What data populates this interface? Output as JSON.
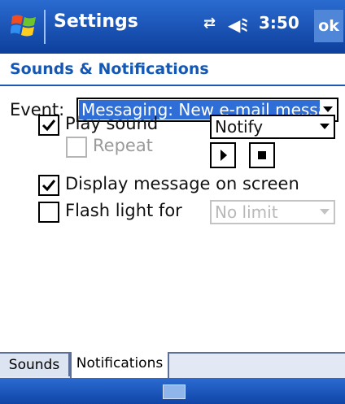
{
  "titlebar": {
    "title": "Settings",
    "connectivity_icon": "connectivity-icon",
    "volume_icon": "volume-icon",
    "time": "3:50",
    "ok_label": "ok"
  },
  "page": {
    "title": "Sounds & Notifications"
  },
  "event": {
    "label": "Event:",
    "value": "Messaging: New e-mail messag"
  },
  "play_sound": {
    "label": "Play sound",
    "checked": true,
    "sound_value": "Notify",
    "play_icon": "play-icon",
    "stop_icon": "stop-icon"
  },
  "repeat": {
    "label": "Repeat",
    "checked": false,
    "enabled": false
  },
  "display_message": {
    "label": "Display message on screen",
    "checked": true
  },
  "flash_light": {
    "label": "Flash light for",
    "checked": false,
    "duration_value": "No limit",
    "enabled": false
  },
  "tabs": [
    {
      "label": "Sounds",
      "active": false
    },
    {
      "label": "Notifications",
      "active": true
    }
  ],
  "bottombar": {
    "keyboard_icon": "keyboard-icon"
  },
  "colors": {
    "title_bar": "#0d3f9c",
    "header_text": "#1458b6",
    "selection": "#2f6ed6"
  }
}
